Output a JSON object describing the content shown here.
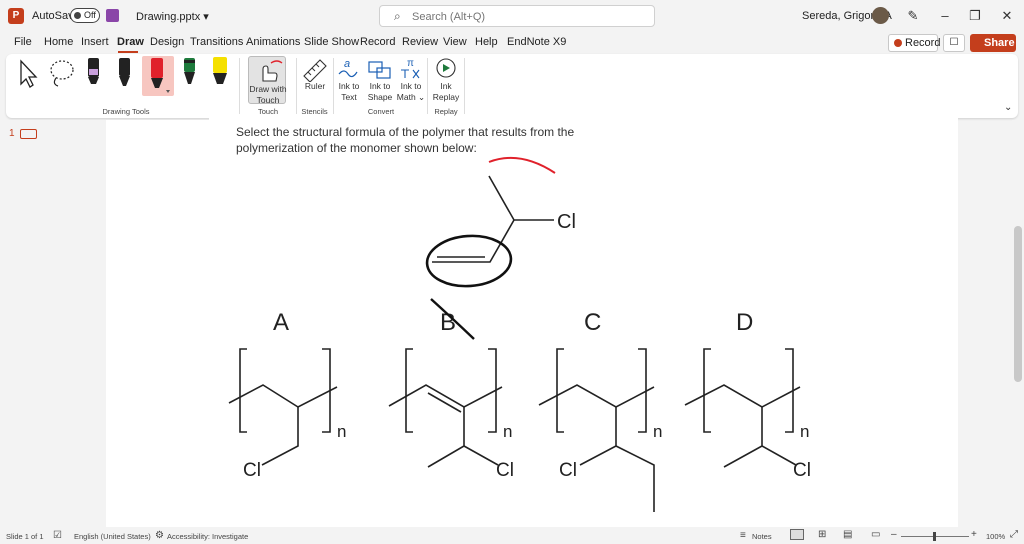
{
  "titlebar": {
    "autosave_label": "AutoSave",
    "autosave_state": "Off",
    "filename": "Drawing.pptx ▾",
    "search_placeholder": "Search (Alt+Q)",
    "user_name": "Sereda, Grigoriy A",
    "icons": [
      "powerpoint-logo",
      "save-icon",
      "search-icon",
      "pen-icon",
      "minimize-icon",
      "restore-icon",
      "close-icon"
    ]
  },
  "tabs": [
    "File",
    "Home",
    "Insert",
    "Draw",
    "Design",
    "Transitions",
    "Animations",
    "Slide Show",
    "Record",
    "Review",
    "View",
    "Help",
    "EndNote X9"
  ],
  "active_tab": "Draw",
  "actions": {
    "record": "Record",
    "share": "Share"
  },
  "ribbon": {
    "groups": {
      "drawing_tools": "Drawing Tools",
      "touch": "Touch",
      "stencils": "Stencils",
      "convert": "Convert",
      "replay": "Replay"
    },
    "buttons": {
      "draw_with_touch": [
        "Draw with",
        "Touch"
      ],
      "ruler": "Ruler",
      "ink_to_text": [
        "Ink to",
        "Text"
      ],
      "ink_to_shape": [
        "Ink to",
        "Shape"
      ],
      "ink_to_math": [
        "Ink to",
        "Math ⌄"
      ],
      "ink_replay": [
        "Ink",
        "Replay"
      ]
    },
    "pen_colors": [
      "#000000",
      "#000000",
      "#e0212b",
      "#1e7a3c",
      "#f5e000"
    ],
    "highlighter_color": "#c9a0dc"
  },
  "left_pane": {
    "slide_number": "1"
  },
  "slide": {
    "question_line1": "Select the structural formula of the polymer that results from the",
    "question_line2": "polymerization of the monomer shown below:",
    "monomer_substituent": "Cl",
    "options": [
      {
        "letter": "A",
        "subscript": "n",
        "substituent": "Cl"
      },
      {
        "letter": "B",
        "subscript": "n",
        "substituent": "Cl"
      },
      {
        "letter": "C",
        "subscript": "n",
        "substituent": "Cl"
      },
      {
        "letter": "D",
        "subscript": "n",
        "substituent": "Cl"
      }
    ],
    "ink_color": "#e0212b"
  },
  "statusbar": {
    "slide_info": "Slide 1 of 1",
    "language": "English (United States)",
    "accessibility": "Accessibility: Investigate",
    "notes": "Notes",
    "zoom": "100%"
  }
}
